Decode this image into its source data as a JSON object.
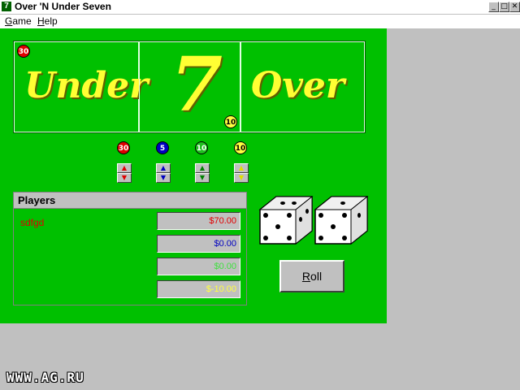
{
  "window": {
    "title": "Over 'N Under Seven",
    "icon_glyph": "7",
    "btn_min": "_",
    "btn_max": "□",
    "btn_close": "✕"
  },
  "menu": {
    "items": [
      {
        "label": "Game",
        "accel": "G"
      },
      {
        "label": "Help",
        "accel": "H"
      }
    ]
  },
  "board": {
    "under_label": "Under",
    "seven_label": "7",
    "over_label": "Over"
  },
  "board_chips": {
    "under": "30",
    "seven": "10"
  },
  "bet_chips": [
    {
      "value": "30",
      "color": "#e00000",
      "text_color": "#ffffff"
    },
    {
      "value": "5",
      "color": "#0000c0",
      "text_color": "#ffffff"
    },
    {
      "value": "10",
      "color": "#20c020",
      "text_color": "#ffffff"
    },
    {
      "value": "10",
      "color": "#ffff40",
      "text_color": "#000000"
    }
  ],
  "spin_colors": [
    "#e00000",
    "#0000c0",
    "#008000",
    "#e0e000"
  ],
  "players": {
    "header": "Players",
    "name": "sdfgd",
    "name_color": "#e00000",
    "balances": [
      {
        "value": "$70.00",
        "color": "#e00000"
      },
      {
        "value": "$0.00",
        "color": "#0000c0"
      },
      {
        "value": "$0.00",
        "color": "#40e040"
      },
      {
        "value": "$-10.00",
        "color": "#ffff40"
      }
    ]
  },
  "dice": [
    5,
    5
  ],
  "roll_button": "Roll",
  "watermark": "WWW.AG.RU"
}
